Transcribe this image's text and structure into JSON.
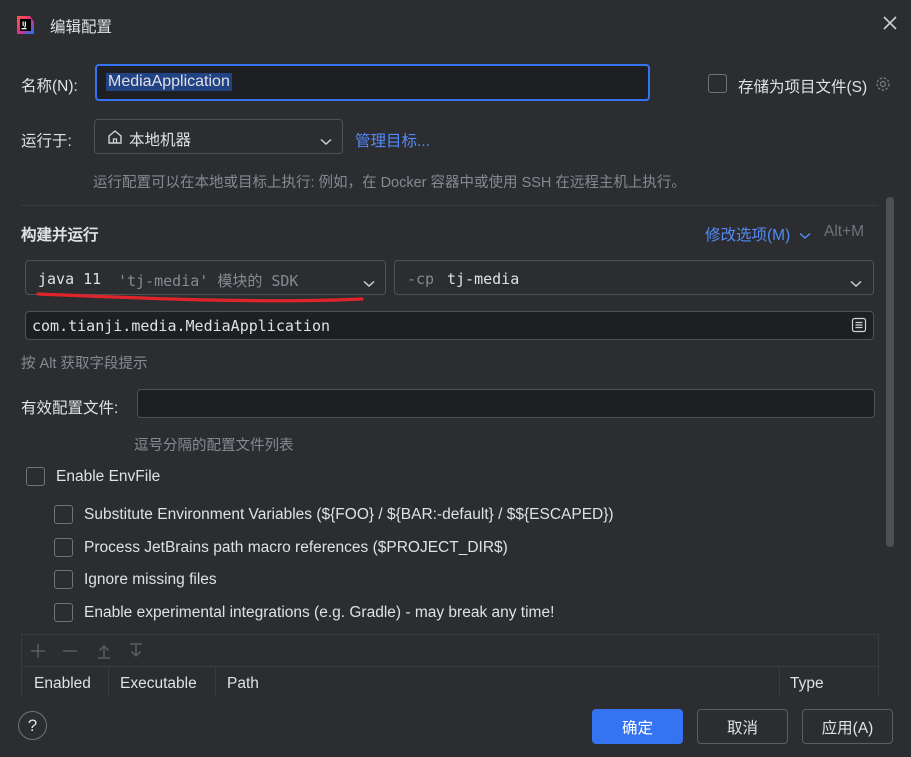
{
  "window": {
    "title": "编辑配置",
    "app_icon": "intellij-idea-icon",
    "close_icon": "close-icon"
  },
  "name_row": {
    "label": "名称(N):",
    "value": "MediaApplication",
    "store_label": "存储为项目文件(S)",
    "store_checked": false
  },
  "run_on": {
    "label": "运行于:",
    "target": "本地机器",
    "manage_link": "管理目标...",
    "hint": "运行配置可以在本地或目标上执行: 例如，在 Docker 容器中或使用 SSH 在远程主机上执行。"
  },
  "build_run": {
    "heading": "构建并运行",
    "modify_options": "修改选项(M)",
    "shortcut": "Alt+M",
    "jdk": {
      "name": "java 11",
      "detail": "'tj-media' 模块的 SDK"
    },
    "classpath": {
      "prefix": "-cp",
      "module": "tj-media"
    },
    "main_class": "com.tianji.media.MediaApplication",
    "alt_hint": "按 Alt 获取字段提示"
  },
  "profiles": {
    "label": "有效配置文件:",
    "value": "",
    "hint": "逗号分隔的配置文件列表"
  },
  "envfile": {
    "enable_label": "Enable EnvFile",
    "options": [
      "Substitute Environment Variables (${FOO} / ${BAR:-default} / $${ESCAPED})",
      "Process JetBrains path macro references ($PROJECT_DIR$)",
      "Ignore missing files",
      "Enable experimental integrations (e.g. Gradle) - may break any time!"
    ],
    "table_headers": [
      "Enabled",
      "Executable",
      "Path",
      "Type"
    ]
  },
  "footer": {
    "help": "?",
    "ok": "确定",
    "cancel": "取消",
    "apply": "应用(A)"
  },
  "colors": {
    "accent": "#3574f0",
    "link": "#548af7",
    "annotation": "#e0242b"
  }
}
